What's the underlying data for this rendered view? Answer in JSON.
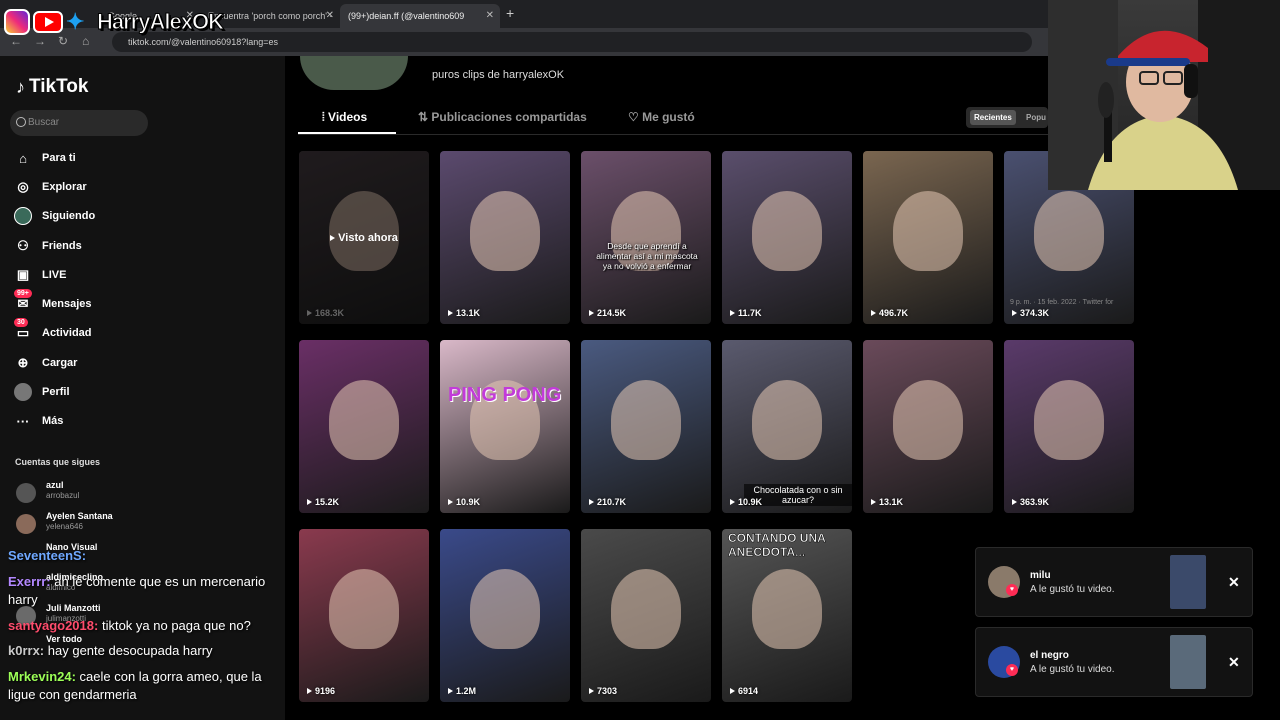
{
  "overlay": {
    "streamer_name": "HarryAlexOK"
  },
  "browser": {
    "tabs": [
      {
        "label": "Google"
      },
      {
        "label": "Encuentra 'porch como porch' -"
      },
      {
        "label": "(99+)deian.ff (@valentino609"
      }
    ],
    "url": "tiktok.com/@valentino60918?lang=es"
  },
  "sidebar": {
    "brand": "TikTok",
    "search_placeholder": "Buscar",
    "nav": [
      {
        "label": "Para ti",
        "icon": "home-icon"
      },
      {
        "label": "Explorar",
        "icon": "compass-icon"
      },
      {
        "label": "Siguiendo",
        "icon": "following-avatar-icon"
      },
      {
        "label": "Friends",
        "icon": "friends-icon"
      },
      {
        "label": "LIVE",
        "icon": "live-icon"
      },
      {
        "label": "Mensajes",
        "icon": "messages-icon",
        "badge": "99+"
      },
      {
        "label": "Actividad",
        "icon": "activity-icon",
        "badge": "30"
      },
      {
        "label": "Cargar",
        "icon": "upload-icon"
      },
      {
        "label": "Perfil",
        "icon": "profile-icon"
      },
      {
        "label": "Más",
        "icon": "more-icon"
      }
    ],
    "following_title": "Cuentas que sigues",
    "following": [
      {
        "name": "azul",
        "handle": "arrobazul"
      },
      {
        "name": "Ayelen Santana",
        "handle": "yelena646"
      },
      {
        "name": "Nano Visual",
        "handle": ""
      },
      {
        "name": "aldimiceclino",
        "handle": "aldimico"
      },
      {
        "name": "Juli Manzotti",
        "handle": "julimanzotti"
      },
      {
        "name": "Ver todo",
        "handle": ""
      }
    ]
  },
  "chat": [
    {
      "user": "SeventeenS:",
      "color": "#6fa8ff",
      "text": ""
    },
    {
      "user": "Exerrr:",
      "color": "#b388ff",
      "text": "ah le comente que es un mercenario harry"
    },
    {
      "user": "santyago2018:",
      "color": "#ff4d6d",
      "text": "tiktok ya no paga que no?"
    },
    {
      "user": "k0rrx:",
      "color": "#c9c9c9",
      "text": "hay gente desocupada harry"
    },
    {
      "user": "Mrkevin24:",
      "color": "#9cff57",
      "text": "caele con la gorra ameo, que la ligue con gendarmeria"
    }
  ],
  "profile": {
    "bio": "puros clips de harryalexOK",
    "tabs": [
      {
        "label": "Videos",
        "active": true
      },
      {
        "label": "Publicaciones compartidas",
        "active": false
      },
      {
        "label": "Me gustó",
        "active": false
      }
    ],
    "sort": [
      {
        "label": "Recientes",
        "active": true
      },
      {
        "label": "Popu",
        "active": false
      }
    ]
  },
  "videos": [
    {
      "views": "168.3K",
      "watched_label": "Visto ahora",
      "bg": "#3a3236"
    },
    {
      "views": "13.1K",
      "bg": "#5b4a6e"
    },
    {
      "views": "214.5K",
      "caption": "Desde que aprendí a alimentar así a mi mascota ya no volvió a enfermar",
      "bg": "#6b4f6a"
    },
    {
      "views": "11.7K",
      "bg": "#5a4e6c"
    },
    {
      "views": "496.7K",
      "bg": "#7a6650"
    },
    {
      "views": "374.3K",
      "date": "9 p. m. · 15 feb. 2022 · Twitter for",
      "bg": "#4a5070"
    },
    {
      "views": "15.2K",
      "bg": "#6a2f66"
    },
    {
      "views": "10.9K",
      "overlay": "PING PONG",
      "bg": "#d9b8c8"
    },
    {
      "views": "210.7K",
      "bg": "#4a5a80"
    },
    {
      "views": "10.9K",
      "caption2": "Chocolatada con o sin azucar?",
      "bg": "#5a5a6e"
    },
    {
      "views": "13.1K",
      "bg": "#6a4a5a"
    },
    {
      "views": "363.9K",
      "bg": "#5a3a6a"
    },
    {
      "views": "9196",
      "bg": "#8a3a4e"
    },
    {
      "views": "1.2M",
      "bg": "#3a4a8a"
    },
    {
      "views": "7303",
      "bg": "#4a4a4a"
    },
    {
      "views": "6914",
      "overlay": "CONTANDO UNA ANECDOTA...",
      "bg": "#555555"
    }
  ],
  "notifications": [
    {
      "name": "milu",
      "text": "A le gustó tu video."
    },
    {
      "name": "el negro",
      "text": "A le gustó tu video."
    }
  ]
}
